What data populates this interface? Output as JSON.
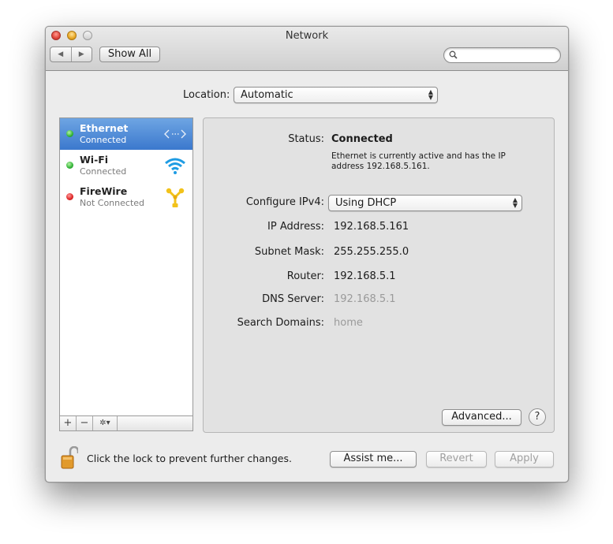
{
  "window": {
    "title": "Network"
  },
  "toolbar": {
    "back": "◀",
    "forward": "▶",
    "show_all": "Show All",
    "search_icon": "magnifier-icon",
    "search_placeholder": ""
  },
  "location": {
    "label": "Location:",
    "value": "Automatic"
  },
  "services": [
    {
      "name": "Ethernet",
      "status": "Connected",
      "dot": "green",
      "icon": "ethernet-arrows-icon",
      "selected": true
    },
    {
      "name": "Wi-Fi",
      "status": "Connected",
      "dot": "green",
      "icon": "wifi-icon",
      "selected": false
    },
    {
      "name": "FireWire",
      "status": "Not Connected",
      "dot": "red",
      "icon": "firewire-icon",
      "selected": false
    }
  ],
  "service_toolbar": {
    "add": "+",
    "remove": "−",
    "action": "✲▾"
  },
  "detail": {
    "status_label": "Status:",
    "status_value": "Connected",
    "status_desc": "Ethernet is currently active and has the IP address 192.168.5.161.",
    "configure_label": "Configure IPv4:",
    "configure_value": "Using DHCP",
    "ip_label": "IP Address:",
    "ip_value": "192.168.5.161",
    "subnet_label": "Subnet Mask:",
    "subnet_value": "255.255.255.0",
    "router_label": "Router:",
    "router_value": "192.168.5.1",
    "dns_label": "DNS Server:",
    "dns_value": "192.168.5.1",
    "search_label": "Search Domains:",
    "search_value": "home",
    "advanced": "Advanced...",
    "help": "?"
  },
  "footer": {
    "lock_text": "Click the lock to prevent further changes.",
    "assist": "Assist me...",
    "revert": "Revert",
    "apply": "Apply"
  },
  "colors": {
    "selection": "#3b78cd",
    "connected": "#30b236",
    "not_connected": "#dd2424",
    "accent_blue": "#1f9ce3",
    "firewire_yellow": "#f2c21a"
  }
}
